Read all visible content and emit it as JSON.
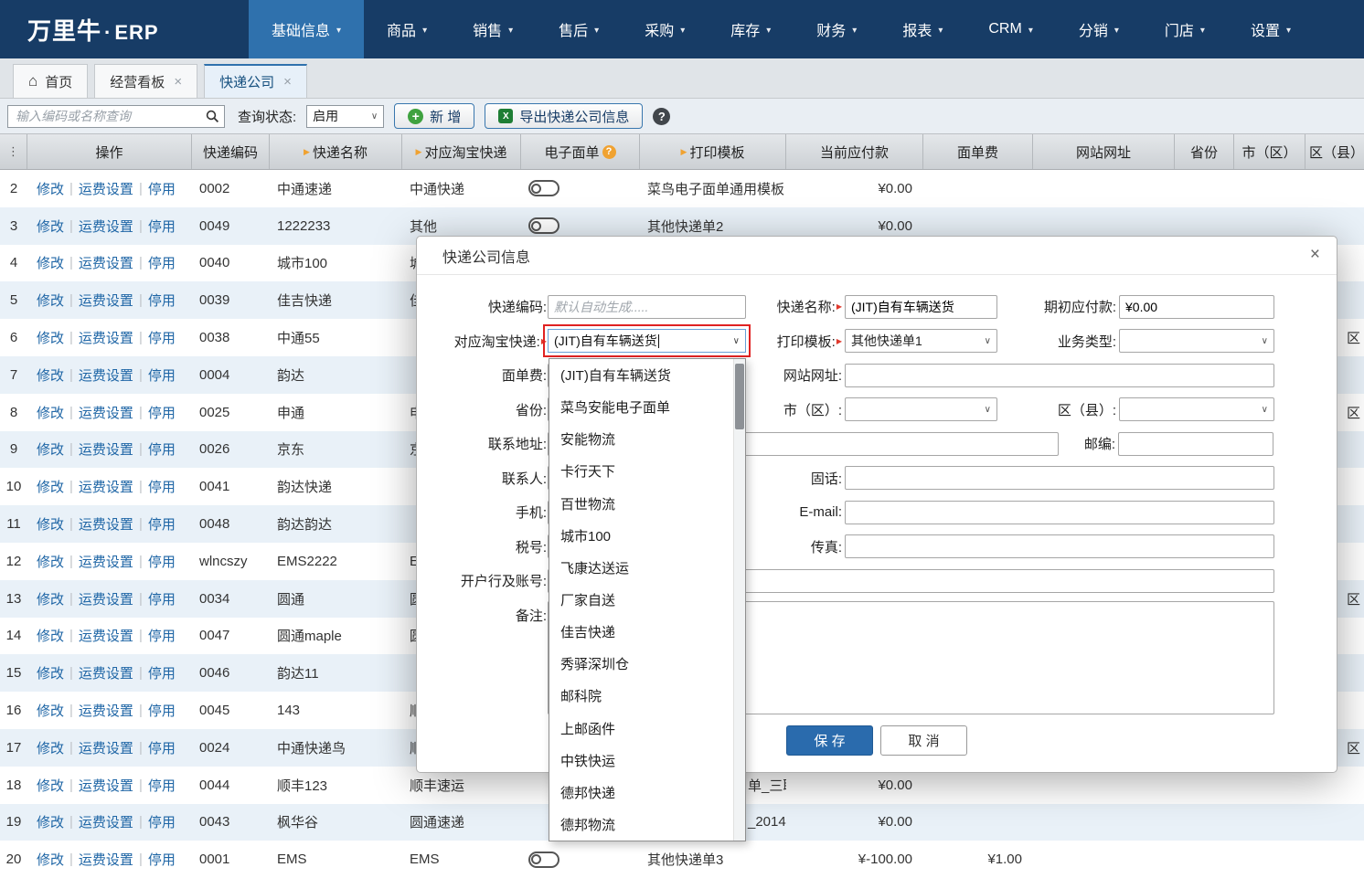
{
  "brand": {
    "name": "万里牛",
    "dot": "·",
    "suffix": "ERP"
  },
  "colors": {
    "navy": "#173c66",
    "accent": "#2f71ad",
    "link": "#1f66a6",
    "highlight": "#e02222",
    "save": "#2a6bad",
    "green": "#3fa23f",
    "sort": "#f0a231"
  },
  "icons": {
    "menu_dots": "⋮",
    "home": "⌂",
    "close": "×",
    "nav_caret": "▾",
    "select_caret": "∨",
    "sort": "▶",
    "required": "▶",
    "help": "?",
    "plus": "+",
    "excel": "X"
  },
  "nav": {
    "items": [
      {
        "label": "基础信息",
        "active": true
      },
      {
        "label": "商品",
        "active": false
      },
      {
        "label": "销售",
        "active": false
      },
      {
        "label": "售后",
        "active": false
      },
      {
        "label": "采购",
        "active": false
      },
      {
        "label": "库存",
        "active": false
      },
      {
        "label": "财务",
        "active": false
      },
      {
        "label": "报表",
        "active": false
      },
      {
        "label": "CRM",
        "active": false
      },
      {
        "label": "分销",
        "active": false
      },
      {
        "label": "门店",
        "active": false
      },
      {
        "label": "设置",
        "active": false
      }
    ]
  },
  "tabs": [
    {
      "label": "首页",
      "icon": "home",
      "closable": false,
      "active": false
    },
    {
      "label": "经营看板",
      "icon": "",
      "closable": true,
      "active": false
    },
    {
      "label": "快递公司",
      "icon": "",
      "closable": true,
      "active": true
    }
  ],
  "toolbar": {
    "search_placeholder": "输入编码或名称查询",
    "status_label": "查询状态:",
    "status_value": "启用",
    "add_button": "新 增",
    "export_button": "导出快递公司信息"
  },
  "table": {
    "headers": [
      {
        "label": "操作",
        "sort": false,
        "help": false
      },
      {
        "label": "快递编码",
        "sort": false,
        "help": false
      },
      {
        "label": "快递名称",
        "sort": true,
        "help": false
      },
      {
        "label": "对应淘宝快递",
        "sort": true,
        "help": false
      },
      {
        "label": "电子面单",
        "sort": false,
        "help": true
      },
      {
        "label": "打印模板",
        "sort": true,
        "help": false
      },
      {
        "label": "当前应付款",
        "sort": false,
        "help": false
      },
      {
        "label": "面单费",
        "sort": false,
        "help": false
      },
      {
        "label": "网站网址",
        "sort": false,
        "help": false
      },
      {
        "label": "省份",
        "sort": false,
        "help": false
      },
      {
        "label": "市（区）",
        "sort": false,
        "help": false
      },
      {
        "label": "区（县）",
        "sort": false,
        "help": false
      }
    ],
    "row_actions": [
      "修改",
      "运费设置",
      "停用"
    ],
    "rows": [
      {
        "num": 2,
        "code": "0002",
        "name": "中通速递",
        "taobao": "中通快递",
        "toggle": true,
        "template": "菜鸟电子面单通用模板",
        "payable": "¥0.00",
        "fee": "",
        "district": ""
      },
      {
        "num": 3,
        "code": "0049",
        "name": "1222233",
        "taobao": "其他",
        "toggle": true,
        "template": "其他快递单2",
        "payable": "¥0.00",
        "fee": "",
        "district": ""
      },
      {
        "num": 4,
        "code": "0040",
        "name": "城市100",
        "taobao": "城",
        "toggle": false,
        "template": "",
        "payable": "",
        "fee": "",
        "district": ""
      },
      {
        "num": 5,
        "code": "0039",
        "name": "佳吉快递",
        "taobao": "佳",
        "toggle": false,
        "template": "",
        "payable": "",
        "fee": "",
        "district": ""
      },
      {
        "num": 6,
        "code": "0038",
        "name": "中通55",
        "taobao": "",
        "toggle": false,
        "template": "",
        "payable": "",
        "fee": "",
        "district": "区"
      },
      {
        "num": 7,
        "code": "0004",
        "name": "韵达",
        "taobao": "",
        "toggle": false,
        "template": "",
        "payable": "",
        "fee": "",
        "district": ""
      },
      {
        "num": 8,
        "code": "0025",
        "name": "申通",
        "taobao": "申",
        "toggle": false,
        "template": "",
        "payable": "",
        "fee": "",
        "district": "区"
      },
      {
        "num": 9,
        "code": "0026",
        "name": "京东",
        "taobao": "京",
        "toggle": false,
        "template": "",
        "payable": "",
        "fee": "",
        "district": ""
      },
      {
        "num": 10,
        "code": "0041",
        "name": "韵达快递",
        "taobao": "",
        "toggle": false,
        "template": "",
        "payable": "",
        "fee": "",
        "district": ""
      },
      {
        "num": 11,
        "code": "0048",
        "name": "韵达韵达",
        "taobao": "",
        "toggle": false,
        "template": "",
        "payable": "",
        "fee": "",
        "district": ""
      },
      {
        "num": 12,
        "code": "wlncszy",
        "name": "EMS2222",
        "taobao": "E",
        "toggle": false,
        "template": "",
        "payable": "",
        "fee": "",
        "district": ""
      },
      {
        "num": 13,
        "code": "0034",
        "name": "圆通",
        "taobao": "圆",
        "toggle": false,
        "template": "",
        "payable": "",
        "fee": "",
        "district": "区"
      },
      {
        "num": 14,
        "code": "0047",
        "name": "圆通maple",
        "taobao": "圆",
        "toggle": false,
        "template": "",
        "payable": "",
        "fee": "",
        "district": ""
      },
      {
        "num": 15,
        "code": "0046",
        "name": "韵达11",
        "taobao": "",
        "toggle": false,
        "template": "",
        "payable": "",
        "fee": "",
        "district": ""
      },
      {
        "num": 16,
        "code": "0045",
        "name": "143",
        "taobao": "顺",
        "toggle": false,
        "template": "",
        "payable": "",
        "fee": "",
        "district": ""
      },
      {
        "num": 17,
        "code": "0024",
        "name": "中通快递鸟",
        "taobao": "顺",
        "toggle": false,
        "template": "",
        "payable": "",
        "fee": "",
        "district": "区"
      },
      {
        "num": 18,
        "code": "0044",
        "name": "顺丰123",
        "taobao": "顺丰速运",
        "toggle": false,
        "template": "单_三联",
        "template_indent": true,
        "payable": "¥0.00",
        "fee": "",
        "district": ""
      },
      {
        "num": 19,
        "code": "0043",
        "name": "枫华谷",
        "taobao": "圆通速递",
        "toggle": false,
        "template": "_2014",
        "template_indent": true,
        "payable": "¥0.00",
        "fee": "",
        "district": ""
      },
      {
        "num": 20,
        "code": "0001",
        "name": "EMS",
        "taobao": "EMS",
        "toggle": true,
        "template": "其他快递单3",
        "payable": "¥-100.00",
        "fee": "¥1.00",
        "district": ""
      }
    ]
  },
  "modal": {
    "title": "快递公司信息",
    "fields": {
      "code_label": "快递编码:",
      "code_placeholder": "默认自动生成.....",
      "name_label": "快递名称:",
      "name_value": "(JIT)自有车辆送货",
      "opening_label": "期初应付款:",
      "opening_value": "¥0.00",
      "taobao_label": "对应淘宝快递:",
      "taobao_value": "(JIT)自有车辆送货",
      "print_label": "打印模板:",
      "print_value": "其他快递单1",
      "biztype_label": "业务类型:",
      "fee_label": "面单费:",
      "website_label": "网站网址:",
      "province_label": "省份:",
      "city_label": "市（区）:",
      "district_label": "区（县）:",
      "address_label": "联系地址:",
      "zip_label": "邮编:",
      "contact_label": "联系人:",
      "tel_label": "固话:",
      "mobile_label": "手机:",
      "email_label": "E-mail:",
      "tax_label": "税号:",
      "fax_label": "传真:",
      "bank_label": "开户行及账号:",
      "remark_label": "备注:"
    },
    "save_button": "保 存",
    "cancel_button": "取 消"
  },
  "dropdown": {
    "options": [
      "(JIT)自有车辆送货",
      "菜鸟安能电子面单",
      "安能物流",
      "卡行天下",
      "百世物流",
      "城市100",
      "飞康达送运",
      "厂家自送",
      "佳吉快递",
      "秀驿深圳仓",
      "邮科院",
      "上邮函件",
      "中铁快运",
      "德邦快递",
      "德邦物流"
    ]
  }
}
